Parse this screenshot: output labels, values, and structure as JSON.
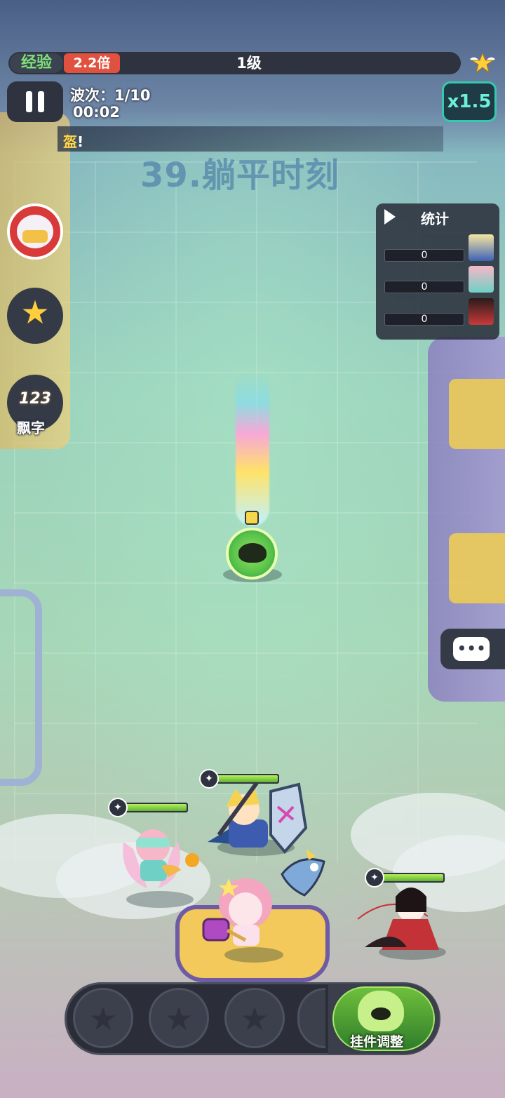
{
  "hud": {
    "exp_label": "经验",
    "exp_multiplier": "2.2倍",
    "level": "1级",
    "wave_label": "波次：1/10",
    "timer": "00:02",
    "speed": "x1.5",
    "ticker_text": "盔",
    "ticker_excl": "!"
  },
  "stage_title": "39.躺平时刻",
  "side_buttons": {
    "float_text_number": "123",
    "float_text_label": "飘字"
  },
  "stats": {
    "title": "统计",
    "rows": [
      {
        "value": "0"
      },
      {
        "value": "0"
      },
      {
        "value": "0"
      }
    ]
  },
  "heroes": [
    {
      "name": "hero-vr-girl",
      "hp": 1.0
    },
    {
      "name": "hero-swordsman",
      "hp": 1.0
    },
    {
      "name": "hero-dancer",
      "hp": 1.0
    }
  ],
  "skill_bar": {
    "plugin_label": "挂件调整"
  },
  "colors": {
    "accent_green": "#7fe07a",
    "multiplier_red": "#e0513f",
    "speed_teal": "#36c9b0",
    "panel_dark": "#2f3340"
  }
}
